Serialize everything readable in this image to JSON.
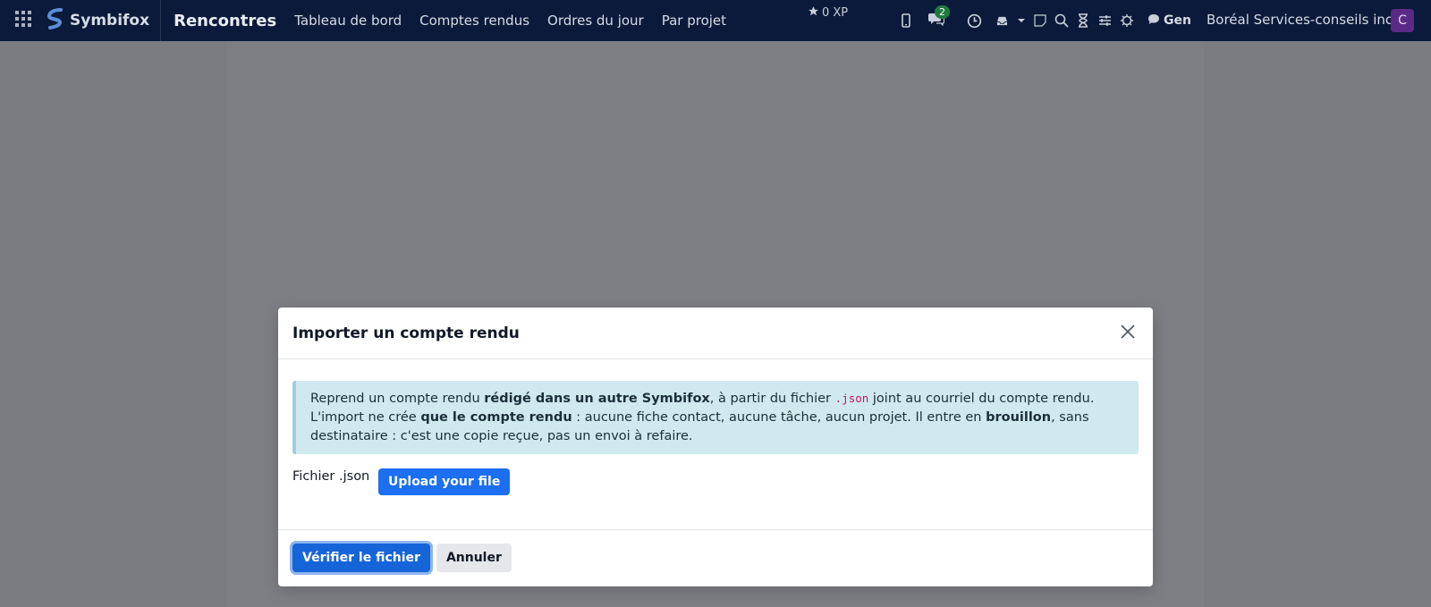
{
  "navbar": {
    "brand": "Symbifox",
    "app_name": "Rencontres",
    "menu": [
      "Tableau de bord",
      "Comptes rendus",
      "Ordres du jour",
      "Par projet"
    ],
    "xp": "0 XP",
    "messages_badge": "2",
    "gen_label": "Gen",
    "company": "Boréal Services-conseils inc.",
    "avatar_initial": "C",
    "colors": {
      "background": "#0b1a3a",
      "avatar": "#5b2a86",
      "badge": "#1f7a3f"
    },
    "icons": [
      "apps-grid-icon",
      "brand-logo-icon",
      "star-icon",
      "mobile-icon",
      "chat-icon",
      "clock-icon",
      "inbox-icon",
      "caret-down-icon",
      "note-icon",
      "search-icon",
      "hourglass-icon",
      "sliders-icon",
      "bug-icon",
      "comment-icon"
    ]
  },
  "modal": {
    "title": "Importer un compte rendu",
    "alert": {
      "line1_pre": "Reprend un compte rendu ",
      "line1_bold": "rédigé dans un autre Symbifox",
      "line1_mid": ", à partir du fichier ",
      "line1_code": ".json",
      "line1_post": " joint au courriel du compte rendu.",
      "line2_pre": "L'import ne crée ",
      "line2_bold": "que le compte rendu",
      "line2_mid": " : aucune fiche contact, aucune tâche, aucun projet. Il entre en ",
      "line2_bold2": "brouillon",
      "line2_post": ", sans destinataire : c'est une copie reçue, pas un envoi à refaire."
    },
    "file_label": "Fichier .json",
    "upload_label": "Upload your file",
    "verify_label": "Vérifier le fichier",
    "cancel_label": "Annuler",
    "colors": {
      "primary": "#1565d8",
      "upload": "#1b6ff0",
      "alert_bg": "#cfe9ef"
    }
  }
}
